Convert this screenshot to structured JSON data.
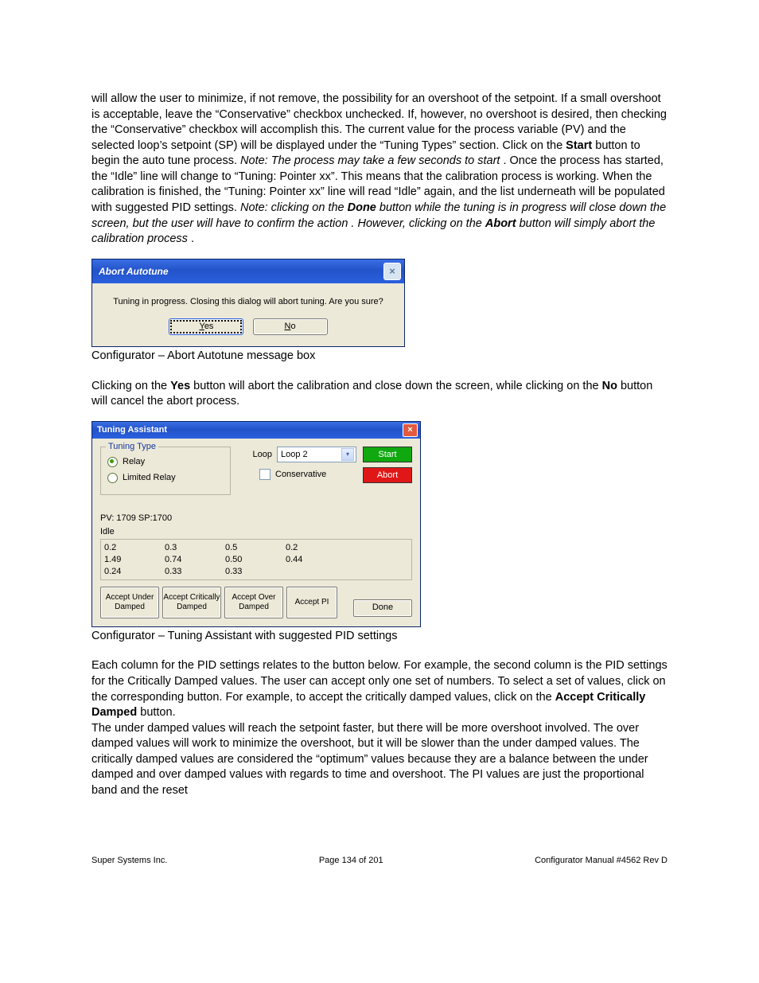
{
  "para1": {
    "a": "will allow the user to minimize, if not remove, the possibility for an overshoot of the setpoint.  If a small overshoot is acceptable, leave the “Conservative” checkbox unchecked.  If, however, no overshoot is desired, then checking the “Conservative” checkbox will accomplish this.  The current value for the process variable (PV) and the selected loop’s setpoint (SP) will be displayed under the “Tuning Types” section.  Click on the ",
    "b": "Start",
    "c": " button to begin the auto tune process.  ",
    "d": "Note: The process may take a few seconds to start",
    "e": ".  Once the process has started, the “Idle” line will change to “Tuning: Pointer xx”.  This means that the calibration process is working.  When the calibration is finished, the “Tuning: Pointer xx” line will read “Idle” again, and the list underneath will be populated with suggested PID settings.  ",
    "f": "Note: clicking on the ",
    "g": "Done",
    "h": " button while the tuning is in progress will close down the screen, but the user will have to confirm the action",
    "i": ".  However, clicking on the ",
    "j": "Abort",
    "k": " button will simply  abort the calibration process",
    "l": "."
  },
  "abortDialog": {
    "title": "Abort Autotune",
    "msg": "Tuning in progress.  Closing this dialog will abort tuning.  Are you sure?",
    "yes": "Yes",
    "no": "No"
  },
  "caption1": "Configurator – Abort Autotune message box",
  "para2": {
    "a": "Clicking on the ",
    "b": "Yes",
    "c": " button will abort the calibration and close down the screen, while clicking on the ",
    "d": "No",
    "e": " button will cancel the abort process."
  },
  "tuneDialog": {
    "title": "Tuning Assistant",
    "group": "Tuning Type",
    "radio1": "Relay",
    "radio2": "Limited Relay",
    "loopLabel": "Loop",
    "loopValue": "Loop 2",
    "consLabel": "Conservative",
    "start": "Start",
    "abort": "Abort",
    "pvsp": "PV: 1709  SP:1700",
    "idle": "Idle",
    "grid": {
      "r0": [
        "0.2",
        "0.3",
        "0.5",
        "0.2"
      ],
      "r1": [
        "1.49",
        "0.74",
        "0.50",
        "0.44"
      ],
      "r2": [
        "0.24",
        "0.33",
        "0.33",
        ""
      ]
    },
    "accept1": "Accept Under Damped",
    "accept2": "Accept Critically Damped",
    "accept3": "Accept Over Damped",
    "accept4": "Accept PI",
    "done": "Done"
  },
  "caption2": "Configurator – Tuning Assistant with suggested PID settings",
  "para3": {
    "a": "Each column for the PID settings relates to the button below.  For example, the second column is the PID settings for the Critically Damped values.  The user can accept only one set of numbers.  To select a set of values, click on the corresponding button.  For example, to accept the critically damped values, click on the ",
    "b": "Accept Critically Damped",
    "c": " button."
  },
  "para4": "The under damped values will reach the setpoint faster, but there will be more overshoot involved.  The over damped values will work to minimize the overshoot, but it will be slower than the under damped values.  The critically damped values are considered the “optimum” values because they are a balance between the under damped and over damped values with regards to time and overshoot.  The PI values are just the proportional band and the reset",
  "footer": {
    "left": "Super Systems Inc.",
    "center": "Page 134 of 201",
    "right": "Configurator Manual #4562 Rev D"
  }
}
